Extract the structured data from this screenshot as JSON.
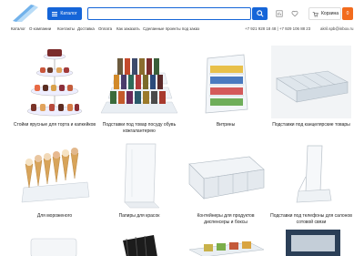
{
  "header": {
    "catalog_label": "Каталог",
    "search_placeholder": "",
    "cart_label": "Корзина",
    "cart_count": "0"
  },
  "nav": {
    "items": [
      "Каталог",
      "О компании",
      "Контакты",
      "Доставка",
      "Оплата",
      "Как заказать",
      "Сделанные проекты под заказ"
    ],
    "phones": "+7 921 928 18 48 | +7 929 106 88 23",
    "email": "akril.spb@inbox.ru"
  },
  "products": [
    {
      "name": "Стойки ярусные для торта и капкейков"
    },
    {
      "name": "Подставки под товар посуду обувь кожгалантерею"
    },
    {
      "name": "Витрины"
    },
    {
      "name": "Подставки под канцелярские товары"
    },
    {
      "name": "Для мороженого"
    },
    {
      "name": "Папиры для красок"
    },
    {
      "name": "Контейнеры для продуктов диспенсеры и боксы"
    },
    {
      "name": "Подставки под телефоны для салонов сотовой связи"
    }
  ],
  "colors": {
    "accent": "#1565d8",
    "cart_badge": "#f26b1d"
  },
  "icons": [
    "logo-icon",
    "menu-icon",
    "search-icon",
    "compare-icon",
    "heart-icon",
    "cart-icon"
  ]
}
